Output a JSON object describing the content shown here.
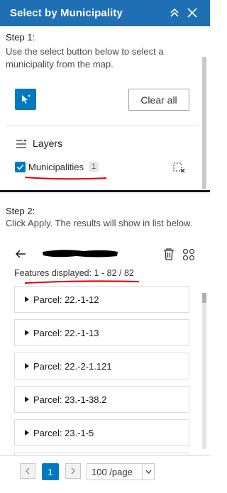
{
  "header": {
    "title": "Select by Municipality",
    "accent": "#1f6fb5"
  },
  "step1": {
    "title": "Step 1:",
    "description": "Use the select button below to select a municipality from the map.",
    "select_icon": "cursor-select-icon",
    "clear_all_label": "Clear all"
  },
  "layers": {
    "title": "Layers",
    "items": [
      {
        "name": "Municipalities",
        "count": "1",
        "checked": true
      }
    ]
  },
  "step2": {
    "title": "Step 2:",
    "description": "Click Apply.  The results will show in list below."
  },
  "results": {
    "features_text": "Features displayed: 1 - 82 / 82",
    "items": [
      {
        "label": "Parcel: 22.-1-12"
      },
      {
        "label": "Parcel: 22.-1-13"
      },
      {
        "label": "Parcel: 22.-2-1.121"
      },
      {
        "label": "Parcel: 23.-1-38.2"
      },
      {
        "label": "Parcel: 23.-1-5"
      },
      {
        "label": ""
      }
    ]
  },
  "pagination": {
    "current_page": "1",
    "page_size": "100 /page"
  },
  "colors": {
    "primary": "#0079c1",
    "annotation_red": "#e00000"
  }
}
